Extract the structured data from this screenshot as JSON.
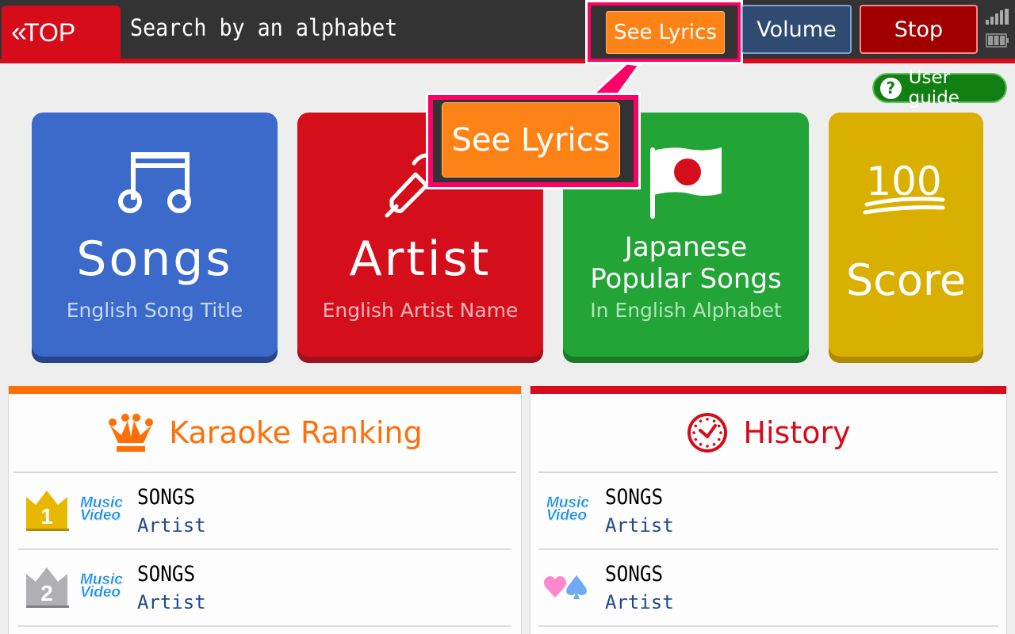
{
  "header": {
    "top_label": "TOP",
    "title": "Search by an alphabet",
    "buttons": {
      "see_lyrics": "See Lyrics",
      "volume": "Volume",
      "stop": "Stop"
    }
  },
  "user_guide": {
    "label": "User guide",
    "icon": "?"
  },
  "callout": {
    "label": "See Lyrics"
  },
  "tiles": [
    {
      "title": "Songs",
      "subtitle": "English Song Title",
      "icon": "music-note-icon",
      "color": "#3b6acb"
    },
    {
      "title": "Artist",
      "subtitle": "English Artist Name",
      "icon": "microphone-icon",
      "color": "#d50e1b"
    },
    {
      "title_line1": "Japanese",
      "title_line2": "Popular Songs",
      "subtitle": "In English Alphabet",
      "icon": "japan-flag-icon",
      "color": "#22a437"
    },
    {
      "title": "Score",
      "badge": "100",
      "icon": "hundred-points-icon",
      "color": "#d9af00"
    }
  ],
  "ranking": {
    "title": "Karaoke Ranking",
    "color": "#fe6f08",
    "items": [
      {
        "rank": "1",
        "badge": "Music Video",
        "song": "SONGS",
        "artist": "Artist"
      },
      {
        "rank": "2",
        "badge": "Music Video",
        "song": "SONGS",
        "artist": "Artist"
      }
    ]
  },
  "history": {
    "title": "History",
    "color": "#d60c1a",
    "items": [
      {
        "badge": "Music Video",
        "song": "SONGS",
        "artist": "Artist"
      },
      {
        "badge": "duet-icon",
        "song": "SONGS",
        "artist": "Artist"
      }
    ]
  }
}
